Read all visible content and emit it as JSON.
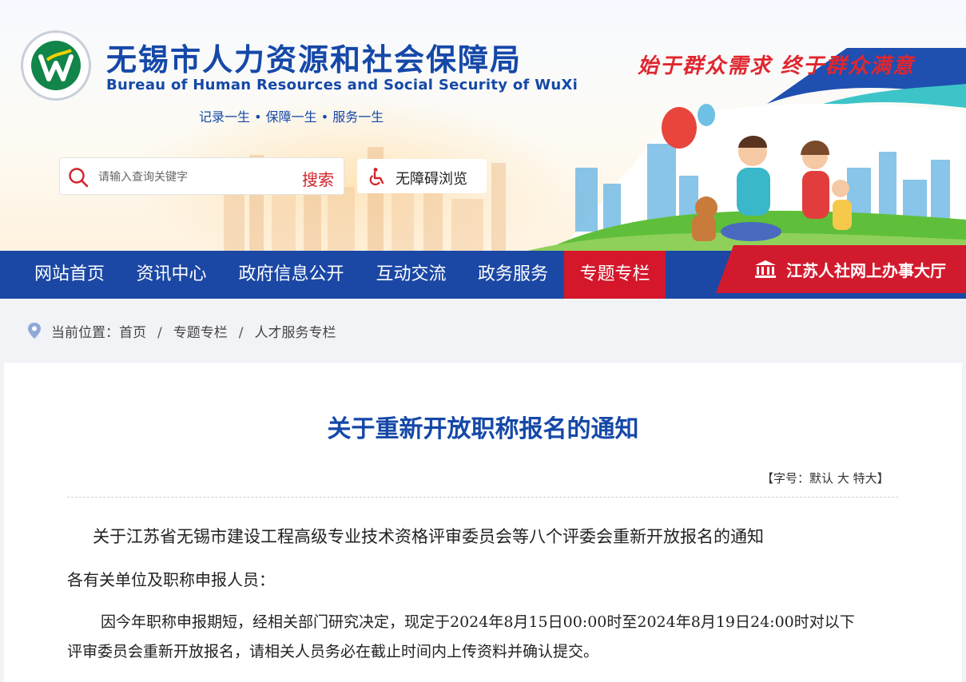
{
  "header": {
    "org_name_cn": "无锡市人力资源和社会保障局",
    "org_name_en": "Bureau of  Human Resources and Social Security of WuXi",
    "motto": "记录一生 • 保障一生 • 服务一生",
    "slogan": "始于群众需求  终于群众满意",
    "search": {
      "placeholder": "请输入查询关键字",
      "button_label": "搜索"
    },
    "accessibility_label": "无障碍浏览"
  },
  "nav": {
    "items": [
      {
        "label": "网站首页",
        "active": false
      },
      {
        "label": "资讯中心",
        "active": false
      },
      {
        "label": "政府信息公开",
        "active": false
      },
      {
        "label": "互动交流",
        "active": false
      },
      {
        "label": "政务服务",
        "active": false
      },
      {
        "label": "专题专栏",
        "active": true
      }
    ],
    "portal_label": "江苏人社网上办事大厅"
  },
  "breadcrumb": {
    "prefix": "当前位置：",
    "items": [
      "首页",
      "专题专栏",
      "人才服务专栏"
    ],
    "separator": "/"
  },
  "article": {
    "title": "关于重新开放职称报名的通知",
    "font_size_label": "【字号：",
    "font_options": [
      "默认",
      "大",
      "特大"
    ],
    "font_size_end": "】",
    "subtitle": "关于江苏省无锡市建设工程高级专业技术资格评审委员会等八个评委会重新开放报名的通知",
    "greeting": "各有关单位及职称申报人员：",
    "para_line1": "因今年职称申报期短，经相关部门研究决定，现定于2024年8月15日00:00时至2024年8月19日24:00时对以下",
    "para_line2": "评审委员会重新开放报名，请相关人员务必在截止时间内上传资料并确认提交。"
  },
  "colors": {
    "brand_blue": "#1b47a5",
    "accent_red": "#d5172b",
    "logo_green": "#12854a"
  }
}
